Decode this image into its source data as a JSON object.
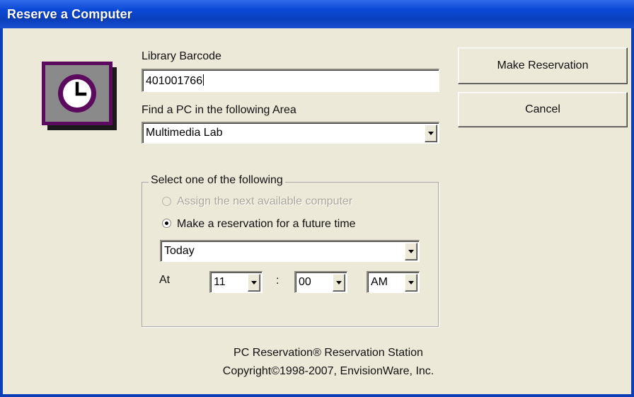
{
  "window": {
    "title": "Reserve a Computer"
  },
  "form": {
    "barcode_label": "Library Barcode",
    "barcode_value": "401001766",
    "area_label": "Find a PC in the following Area",
    "area_value": "Multimedia Lab"
  },
  "buttons": {
    "make_reservation": "Make Reservation",
    "cancel": "Cancel"
  },
  "options": {
    "group_label": "Select one of the following",
    "assign_next_label": "Assign the next available computer",
    "assign_next_enabled": false,
    "future_label": "Make a reservation for a future time",
    "selected": "future",
    "day_value": "Today",
    "at_label": "At",
    "hour_value": "11",
    "time_separator": ":",
    "minute_value": "00",
    "ampm_value": "AM"
  },
  "footer": {
    "product": "PC Reservation® Reservation Station",
    "copyright": "Copyright©1998-2007, EnvisionWare, Inc."
  },
  "icons": {
    "app_icon": "clock-icon",
    "app_icon_colors": {
      "tile": "#8a8a8a",
      "frame": "#5b0a5e",
      "face": "#ffffff",
      "sparkle": "#e8d800"
    }
  }
}
